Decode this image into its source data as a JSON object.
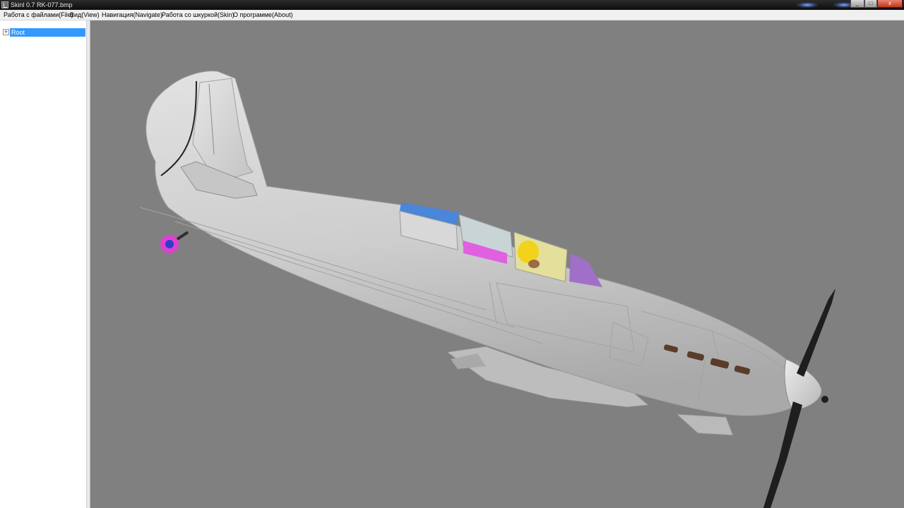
{
  "window": {
    "title": "Skinl 0.7   RK-077.bmp",
    "icon": "app-icon",
    "buttons": {
      "minimize": "_",
      "maximize": "□",
      "close": "x"
    }
  },
  "menu": {
    "items": [
      {
        "label": "Работа с файлами(File)"
      },
      {
        "label": "Вид(View)"
      },
      {
        "label": "Навигация(Navigate)"
      },
      {
        "label": "Работа со шкуркой(Skin)"
      },
      {
        "label": "О программе(About)"
      }
    ]
  },
  "tree": {
    "root": {
      "label": "Root",
      "expander": "+",
      "selected": true
    }
  },
  "viewport": {
    "background": "#808080",
    "model": "aircraft-3d-model",
    "colors": {
      "fuselage": "#cfcfcf",
      "canopy_blue": "#4a86d9",
      "canopy_magenta": "#e060e0",
      "canopy_purple": "#a070c8",
      "pilot_yellow": "#f2d21a",
      "wheel": "#e040d0",
      "propeller": "#1e1e1e"
    }
  }
}
